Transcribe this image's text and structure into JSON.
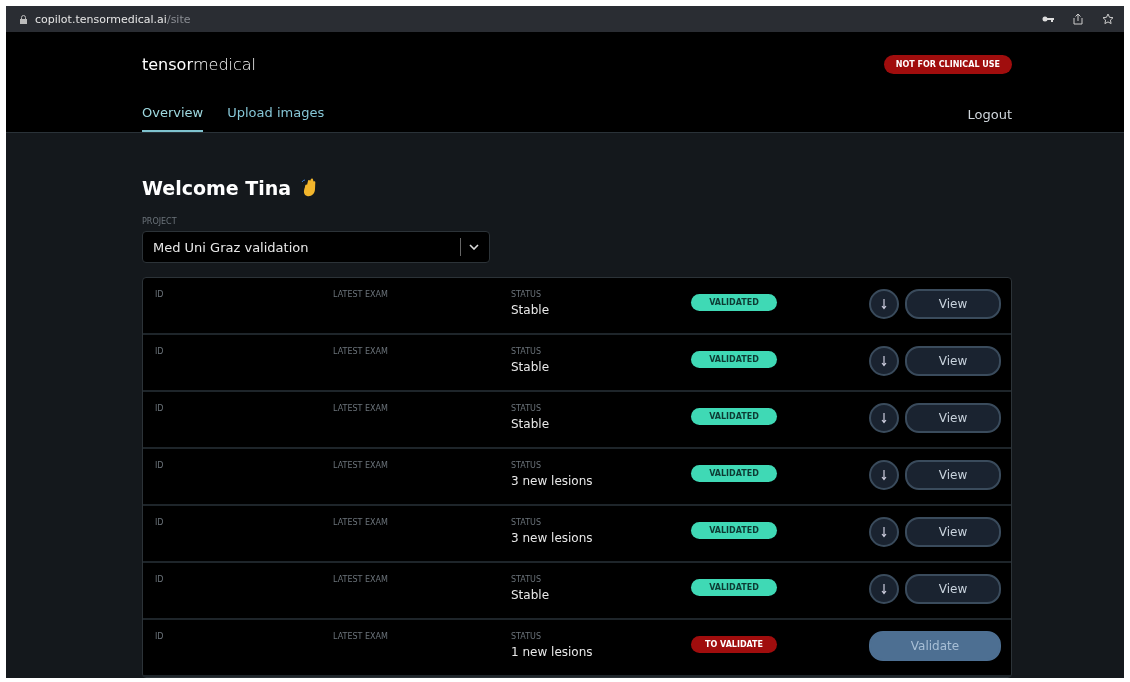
{
  "browser": {
    "url_host": "copilot.tensormedical.ai",
    "url_path": "/site"
  },
  "header": {
    "logo": "**tensor**medical",
    "badge": "NOT FOR CLINICAL USE",
    "logout": "Logout",
    "tabs": [
      {
        "label": "Overview",
        "selected": true
      },
      {
        "label": "Upload images",
        "selected": false
      }
    ]
  },
  "welcome": "Welcome Tina",
  "project": {
    "label": "PROJECT",
    "value": "Med Uni Graz validation"
  },
  "rows": [
    {
      "id_label": "ID",
      "exam_label": "LATEST EXAM",
      "status_label": "STATUS",
      "status": "Stable",
      "kind": "validated",
      "badge": "VALIDATED",
      "action": "View"
    },
    {
      "id_label": "ID",
      "exam_label": "LATEST EXAM",
      "status_label": "STATUS",
      "status": "Stable",
      "kind": "validated",
      "badge": "VALIDATED",
      "action": "View"
    },
    {
      "id_label": "ID",
      "exam_label": "LATEST EXAM",
      "status_label": "STATUS",
      "status": "Stable",
      "kind": "validated",
      "badge": "VALIDATED",
      "action": "View"
    },
    {
      "id_label": "ID",
      "exam_label": "LATEST EXAM",
      "status_label": "STATUS",
      "status": "3 new lesions",
      "kind": "validated",
      "badge": "VALIDATED",
      "action": "View"
    },
    {
      "id_label": "ID",
      "exam_label": "LATEST EXAM",
      "status_label": "STATUS",
      "status": "3 new lesions",
      "kind": "validated",
      "badge": "VALIDATED",
      "action": "View"
    },
    {
      "id_label": "ID",
      "exam_label": "LATEST EXAM",
      "status_label": "STATUS",
      "status": "Stable",
      "kind": "validated",
      "badge": "VALIDATED",
      "action": "View"
    },
    {
      "id_label": "ID",
      "exam_label": "LATEST EXAM",
      "status_label": "STATUS",
      "status": "1 new lesions",
      "kind": "to_validate",
      "badge": "TO VALIDATE",
      "action": "Validate"
    }
  ]
}
